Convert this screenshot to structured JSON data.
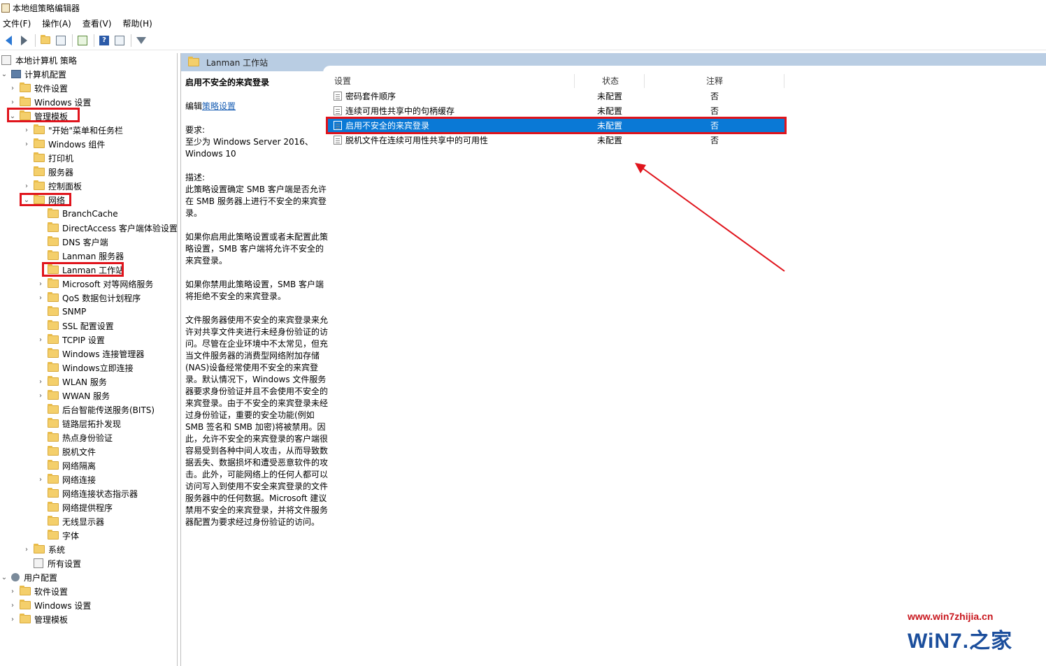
{
  "window": {
    "title": "本地组策略编辑器"
  },
  "menu": [
    "文件(F)",
    "操作(A)",
    "查看(V)",
    "帮助(H)"
  ],
  "toolbar": {
    "icons": [
      "back-arrow-icon",
      "forward-arrow-icon",
      "up-folder-icon",
      "show-hide-tree-icon",
      "export-list-icon",
      "help-icon",
      "properties-icon",
      "filter-icon"
    ],
    "help_glyph": "?"
  },
  "tree": {
    "root": "本地计算机 策略",
    "computer_config": "计算机配置",
    "cc_software": "软件设置",
    "cc_windows": "Windows 设置",
    "cc_admin": "管理模板",
    "start_menu": "\"开始\"菜单和任务栏",
    "windows_components": "Windows 组件",
    "printers": "打印机",
    "servers": "服务器",
    "control_panel": "控制面板",
    "network": "网络",
    "branchcache": "BranchCache",
    "directaccess": "DirectAccess 客户端体验设置",
    "dns_client": "DNS 客户端",
    "lanman_server": "Lanman 服务器",
    "lanman_workstation": "Lanman 工作站",
    "ms_p2p": "Microsoft 对等网络服务",
    "qos": "QoS 数据包计划程序",
    "snmp": "SNMP",
    "ssl": "SSL 配置设置",
    "tcpip": "TCPIP 设置",
    "win_conn_mgr": "Windows 连接管理器",
    "win_instant": "Windows立即连接",
    "wlan": "WLAN 服务",
    "wwan": "WWAN 服务",
    "bits": "后台智能传送服务(BITS)",
    "lltd": "链路层拓扑发现",
    "hotspot": "热点身份验证",
    "offline_files": "脱机文件",
    "net_isolation": "网络隔离",
    "net_connections": "网络连接",
    "net_status": "网络连接状态指示器",
    "net_provider": "网络提供程序",
    "wireless_display": "无线显示器",
    "fonts": "字体",
    "system": "系统",
    "all_settings": "所有设置",
    "user_config": "用户配置",
    "uc_software": "软件设置",
    "uc_windows": "Windows 设置",
    "uc_admin": "管理模板"
  },
  "right": {
    "header": "Lanman 工作站",
    "desc": {
      "title": "启用不安全的来宾登录",
      "edit_prefix": "编辑",
      "edit_link": "策略设置",
      "req_label": "要求:",
      "req_text": "至少为 Windows Server 2016、Windows 10",
      "desc_label": "描述:",
      "p1": "此策略设置确定 SMB 客户端是否允许在 SMB 服务器上进行不安全的来宾登录。",
      "p2": "如果你启用此策略设置或者未配置此策略设置，SMB 客户端将允许不安全的来宾登录。",
      "p3": "如果你禁用此策略设置，SMB 客户端将拒绝不安全的来宾登录。",
      "p4": "文件服务器使用不安全的来宾登录来允许对共享文件夹进行未经身份验证的访问。尽管在企业环境中不太常见，但充当文件服务器的消费型网络附加存储(NAS)设备经常使用不安全的来宾登录。默认情况下，Windows 文件服务器要求身份验证并且不会使用不安全的来宾登录。由于不安全的来宾登录未经过身份验证，重要的安全功能(例如 SMB 签名和 SMB 加密)将被禁用。因此，允许不安全的来宾登录的客户端很容易受到各种中间人攻击，从而导致数据丢失、数据损坏和遭受恶意软件的攻击。此外，可能网络上的任何人都可以访问写入到使用不安全来宾登录的文件服务器中的任何数据。Microsoft 建议禁用不安全的来宾登录，并将文件服务器配置为要求经过身份验证的访问。"
    },
    "columns": {
      "setting": "设置",
      "state": "状态",
      "comment": "注释"
    },
    "rows": [
      {
        "name": "密码套件顺序",
        "state": "未配置",
        "comment": "否"
      },
      {
        "name": "连续可用性共享中的句柄缓存",
        "state": "未配置",
        "comment": "否"
      },
      {
        "name": "启用不安全的来宾登录",
        "state": "未配置",
        "comment": "否"
      },
      {
        "name": "脱机文件在连续可用性共享中的可用性",
        "state": "未配置",
        "comment": "否"
      }
    ]
  },
  "watermark": {
    "url": "www.win7zhijia.cn",
    "logo": "WiN7.之家"
  },
  "colors": {
    "accent": "#e0141c",
    "selection": "#0a79d6",
    "header_bg": "#b9cde3",
    "link": "#1a5fb4"
  }
}
